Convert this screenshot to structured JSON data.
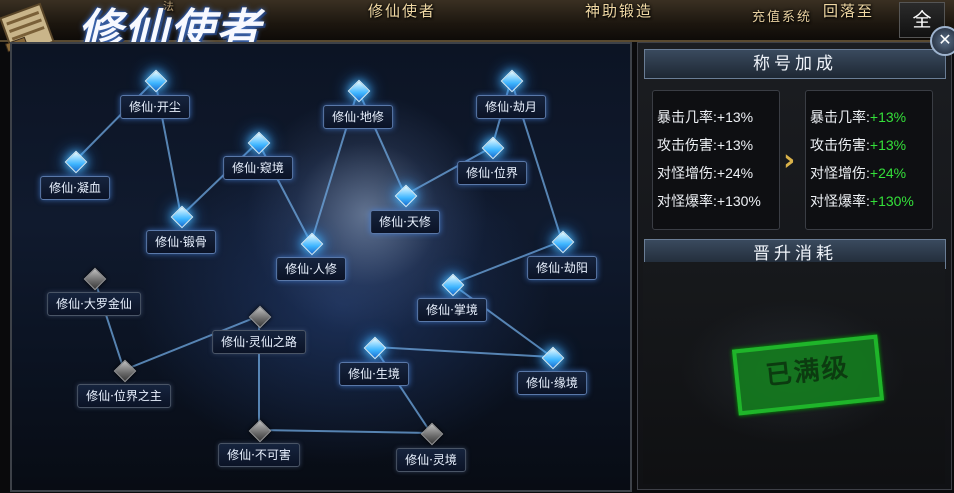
{
  "top_nav": {
    "tabs": [
      {
        "label": "修仙使者"
      },
      {
        "label": "神助锻造"
      },
      {
        "label": "充值系统"
      },
      {
        "label": "回落至"
      }
    ],
    "partial_left": "法",
    "all_button": "全",
    "close": "✕"
  },
  "page_title": "修仙使者",
  "nodes": [
    {
      "id": "kaichen",
      "label": "修仙·开尘",
      "state": "lit"
    },
    {
      "id": "dixiu",
      "label": "修仙·地修",
      "state": "lit"
    },
    {
      "id": "jieyue",
      "label": "修仙·劫月",
      "state": "lit"
    },
    {
      "id": "ningxue",
      "label": "修仙·凝血",
      "state": "lit"
    },
    {
      "id": "kuijing",
      "label": "修仙·窥境",
      "state": "lit"
    },
    {
      "id": "weijie",
      "label": "修仙·位界",
      "state": "lit"
    },
    {
      "id": "tianxiu",
      "label": "修仙·天修",
      "state": "lit"
    },
    {
      "id": "duangu",
      "label": "修仙·锻骨",
      "state": "lit"
    },
    {
      "id": "renxiu",
      "label": "修仙·人修",
      "state": "lit"
    },
    {
      "id": "jieyang",
      "label": "修仙·劫阳",
      "state": "lit"
    },
    {
      "id": "daluo",
      "label": "修仙·大罗金仙",
      "state": "dim"
    },
    {
      "id": "zhangjing",
      "label": "修仙·掌境",
      "state": "lit"
    },
    {
      "id": "lingxian",
      "label": "修仙·灵仙之路",
      "state": "dim"
    },
    {
      "id": "shengjing",
      "label": "修仙·生境",
      "state": "lit"
    },
    {
      "id": "weijiezhizhu",
      "label": "修仙·位界之主",
      "state": "dim"
    },
    {
      "id": "yuanjing",
      "label": "修仙·缘境",
      "state": "lit"
    },
    {
      "id": "bukehai",
      "label": "修仙·不可害",
      "state": "dim"
    },
    {
      "id": "lingjing",
      "label": "修仙·灵境",
      "state": "dim"
    }
  ],
  "bonus": {
    "title": "称号加成",
    "current": [
      {
        "label": "暴击几率:",
        "value": "+13%"
      },
      {
        "label": "攻击伤害:",
        "value": "+13%"
      },
      {
        "label": "对怪增伤:",
        "value": "+24%"
      },
      {
        "label": "对怪爆率:",
        "value": "+130%"
      }
    ],
    "next": [
      {
        "label": "暴击几率:",
        "value": "+13%"
      },
      {
        "label": "攻击伤害:",
        "value": "+13%"
      },
      {
        "label": "对怪增伤:",
        "value": "+24%"
      },
      {
        "label": "对怪爆率:",
        "value": "+130%"
      }
    ],
    "arrow": "›"
  },
  "cost": {
    "title": "晋升消耗",
    "stamp": "已满级"
  },
  "colors": {
    "lit_node": "#3fb6ff",
    "dim_node": "#7a7a7a",
    "bonus_value": "#34e03a",
    "stamp": "#1fb52a"
  }
}
